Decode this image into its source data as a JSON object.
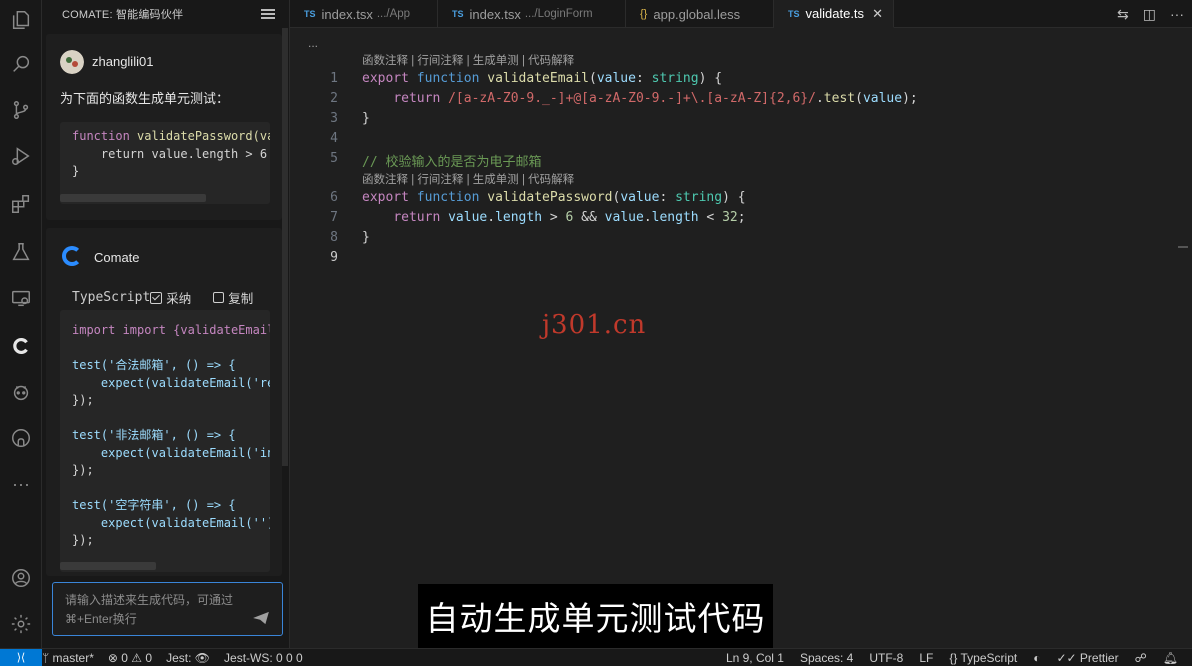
{
  "side_panel": {
    "title": "COMATE: 智能编码伙伴",
    "user": {
      "name": "zhanglili01",
      "prompt": "为下面的函数生成单元测试：",
      "code_lines": [
        "function validatePassword(va",
        "    return value.length > 6",
        "}"
      ]
    },
    "bot": {
      "name": "Comate",
      "language": "TypeScript",
      "accept_label": "采纳",
      "copy_label": "复制",
      "code_lines": [
        "import import {validateEmail",
        "",
        "test('合法邮箱', () => {",
        "    expect(validateEmail('re",
        "});",
        "",
        "test('非法邮箱', () => {",
        "    expect(validateEmail('in",
        "});",
        "",
        "test('空字符串', () => {",
        "    expect(validateEmail('')",
        "});"
      ]
    },
    "input_placeholder_line1": "请输入描述来生成代码，可通过",
    "input_placeholder_line2": "⌘+Enter换行"
  },
  "tabs": [
    {
      "label": "index.tsx",
      "sub": ".../App",
      "badge": "TS"
    },
    {
      "label": "index.tsx",
      "sub": ".../LoginForm",
      "badge": "TS"
    },
    {
      "label": "app.global.less",
      "sub": "",
      "badge": "{}"
    },
    {
      "label": "validate.ts",
      "sub": "",
      "badge": "TS",
      "active": true
    }
  ],
  "editor": {
    "breadcrumb": "...",
    "code_lens": "函数注释 | 行间注释 | 生成单测 | 代码解释",
    "line_numbers": [
      "1",
      "2",
      "3",
      "4",
      "5",
      "6",
      "7",
      "8",
      "9"
    ],
    "comment": "// 校验输入的是否为电子邮箱"
  },
  "watermark": "j301.cn",
  "subtitle": "自动生成单元测试代码",
  "status": {
    "branch": "master*",
    "errors": "0",
    "warnings": "0",
    "jest": "Jest:",
    "jest_ws": "Jest-WS:",
    "jest_ws_values": "0  0  0",
    "position": "Ln 9, Col 1",
    "spaces": "Spaces: 4",
    "encoding": "UTF-8",
    "eol": "LF",
    "language": "TypeScript",
    "prettier": "Prettier"
  }
}
